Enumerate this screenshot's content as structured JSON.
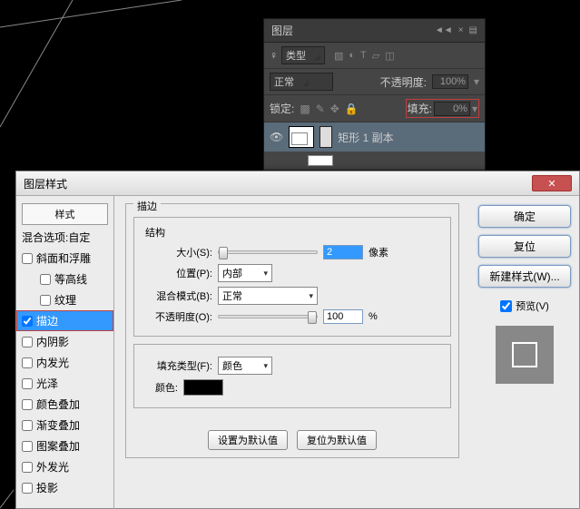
{
  "layersPanel": {
    "title": "图层",
    "kindLabel": "♀",
    "typeLabel": "类型",
    "blendMode": "正常",
    "opacityLabel": "不透明度:",
    "opacityValue": "100%",
    "lockLabel": "锁定:",
    "fillLabel": "填充:",
    "fillValue": "0%",
    "layerName": "矩形 1 副本"
  },
  "dialog": {
    "title": "图层样式",
    "styles": {
      "header": "样式",
      "blendOptions": "混合选项:自定",
      "items": [
        {
          "label": "斜面和浮雕",
          "checked": false
        },
        {
          "label": "等高线",
          "checked": false,
          "indent": true
        },
        {
          "label": "纹理",
          "checked": false,
          "indent": true
        },
        {
          "label": "描边",
          "checked": true,
          "selected": true,
          "hl": true
        },
        {
          "label": "内阴影",
          "checked": false
        },
        {
          "label": "内发光",
          "checked": false
        },
        {
          "label": "光泽",
          "checked": false
        },
        {
          "label": "颜色叠加",
          "checked": false
        },
        {
          "label": "渐变叠加",
          "checked": false
        },
        {
          "label": "图案叠加",
          "checked": false
        },
        {
          "label": "外发光",
          "checked": false
        },
        {
          "label": "投影",
          "checked": false
        }
      ]
    },
    "stroke": {
      "groupLabel": "描边",
      "structureLabel": "结构",
      "sizeLabel": "大小(S):",
      "sizeValue": "2",
      "sizeUnit": "像素",
      "positionLabel": "位置(P):",
      "positionValue": "内部",
      "blendLabel": "混合模式(B):",
      "blendValue": "正常",
      "opacityLabel": "不透明度(O):",
      "opacityValue": "100",
      "opacityUnit": "%",
      "fillTypeLabel": "填充类型(F):",
      "fillTypeValue": "颜色",
      "colorLabel": "颜色:",
      "colorValue": "#000000",
      "makeDefault": "设置为默认值",
      "resetDefault": "复位为默认值"
    },
    "buttons": {
      "ok": "确定",
      "reset": "复位",
      "newStyle": "新建样式(W)...",
      "preview": "预览(V)"
    }
  }
}
